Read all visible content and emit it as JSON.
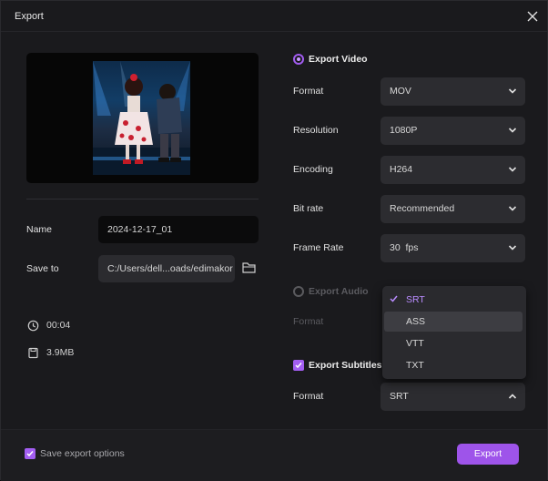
{
  "window": {
    "title": "Export"
  },
  "preview": {},
  "left": {
    "name_label": "Name",
    "name_value": "2024-12-17_01",
    "saveto_label": "Save to",
    "saveto_value": "C:/Users/dell...oads/edimakor",
    "duration": "00:04",
    "size": "3.9MB"
  },
  "export_video": {
    "title": "Export Video",
    "rows": [
      {
        "label": "Format",
        "value": "MOV"
      },
      {
        "label": "Resolution",
        "value": "1080P"
      },
      {
        "label": "Encoding",
        "value": "H264"
      },
      {
        "label": "Bit rate",
        "value": "Recommended"
      },
      {
        "label": "Frame Rate",
        "value": "30  fps"
      }
    ]
  },
  "export_audio": {
    "title": "Export Audio",
    "format_label": "Format"
  },
  "subtitle_dropdown": {
    "options": [
      "SRT",
      "ASS",
      "VTT",
      "TXT"
    ],
    "selected": "SRT",
    "hovered": "ASS"
  },
  "export_subtitles": {
    "title": "Export Subtitles",
    "format_label": "Format",
    "format_value": "SRT"
  },
  "footer": {
    "save_options_label": "Save export options",
    "export_label": "Export"
  },
  "colors": {
    "accent": "#a35ef2",
    "background": "#1a1a1d",
    "field": "#2c2c30"
  }
}
